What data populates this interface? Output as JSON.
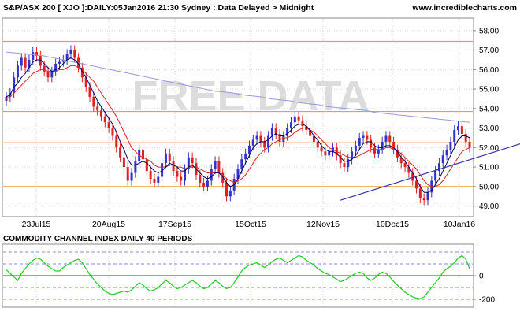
{
  "header": {
    "title": "S&P/ASX 200 [ XJO ]:DAILY:05Jan2016 21:30 Sydney : Data Delayed > Midnight",
    "site": "www.incrediblecharts.com"
  },
  "watermark": "FREE DATA",
  "colors": {
    "up_bar": "#3333cc",
    "down_bar": "#dd2222",
    "ma_fast": "#000066",
    "ma_slow": "#dd2222",
    "ma_long": "#9999dd",
    "hline": "#e8a040",
    "trendline": "#3333aa",
    "cci": "#22cc22",
    "cci_band": "#8888dd",
    "cci_zero": "#3333aa",
    "grid": "#d8d8d8"
  },
  "chart_data": [
    {
      "type": "candlestick",
      "title": "S&P/ASX 200 [ XJO ]:DAILY:05Jan2016 21:30 Sydney : Data Delayed > Midnight",
      "x_ticks": [
        "23Jul15",
        "20Aug15",
        "17Sep15",
        "15Oct15",
        "12Nov15",
        "10Dec15",
        "10Jan16"
      ],
      "y_ticks": [
        "49.00",
        "50.00",
        "51.00",
        "52.00",
        "53.00",
        "54.00",
        "55.00",
        "56.00",
        "57.00",
        "58.00"
      ],
      "ylim": [
        48.5,
        58.6
      ],
      "grid": true,
      "horizontal_lines": [
        57.45,
        53.85,
        52.25,
        50.0
      ],
      "trendline": [
        [
          88,
          49.3
        ],
        [
          142,
          52.6
        ]
      ],
      "close": [
        54.6,
        54.8,
        55.6,
        56.2,
        56.6,
        56.1,
        56.5,
        56.9,
        56.7,
        56.2,
        55.9,
        55.6,
        55.9,
        56.3,
        56.4,
        56.5,
        56.8,
        57.0,
        56.6,
        56.1,
        55.6,
        55.1,
        54.6,
        54.1,
        53.9,
        53.6,
        53.3,
        53.0,
        52.6,
        52.0,
        51.5,
        51.0,
        50.3,
        50.7,
        51.3,
        51.9,
        51.4,
        50.8,
        50.4,
        50.2,
        50.5,
        51.2,
        51.7,
        51.3,
        50.8,
        50.5,
        50.3,
        50.9,
        51.5,
        51.2,
        50.6,
        50.2,
        50.0,
        50.3,
        50.9,
        51.3,
        50.7,
        50.2,
        49.5,
        49.8,
        50.4,
        50.9,
        51.4,
        51.7,
        52.1,
        52.4,
        52.6,
        52.3,
        52.0,
        52.6,
        53.0,
        52.7,
        52.3,
        52.6,
        53.0,
        53.3,
        53.6,
        53.4,
        53.1,
        52.9,
        52.6,
        52.3,
        52.0,
        51.8,
        51.6,
        51.8,
        52.0,
        51.6,
        51.2,
        51.0,
        51.4,
        51.8,
        52.1,
        52.5,
        52.6,
        52.4,
        52.0,
        51.7,
        51.9,
        52.3,
        52.6,
        52.3,
        51.9,
        51.5,
        51.2,
        51.0,
        50.7,
        50.3,
        49.9,
        49.4,
        49.3,
        49.7,
        50.3,
        50.8,
        51.2,
        51.6,
        51.9,
        52.3,
        52.9,
        53.1,
        52.7,
        52.3,
        52.0
      ],
      "ma_fast": [
        54.6,
        54.7,
        55.1,
        55.3,
        55.6,
        55.8,
        56.1,
        56.4,
        56.5,
        56.5,
        56.3,
        56.1,
        55.9,
        56.0,
        56.1,
        56.3,
        56.5,
        56.6,
        56.5,
        56.3,
        55.9,
        55.6,
        55.2,
        54.8,
        54.4,
        54.1,
        53.8,
        53.5,
        53.2,
        52.8,
        52.3,
        51.9,
        51.4,
        51.1,
        51.1,
        51.2,
        51.3,
        51.2,
        51.0,
        50.8,
        50.7,
        50.8,
        51.0,
        51.2,
        51.1,
        51.0,
        50.8,
        50.8,
        51.0,
        51.1,
        50.9,
        50.7,
        50.5,
        50.4,
        50.5,
        50.7,
        50.7,
        50.5,
        50.2,
        50.0,
        50.1,
        50.4,
        50.8,
        51.2,
        51.6,
        52.0,
        52.2,
        52.3,
        52.3,
        52.4,
        52.6,
        52.7,
        52.6,
        52.6,
        52.7,
        52.9,
        53.1,
        53.2,
        53.2,
        53.1,
        52.9,
        52.6,
        52.4,
        52.1,
        51.9,
        51.8,
        51.8,
        51.7,
        51.5,
        51.3,
        51.3,
        51.4,
        51.6,
        51.9,
        52.2,
        52.3,
        52.3,
        52.1,
        52.0,
        52.0,
        52.1,
        52.1,
        52.0,
        51.8,
        51.5,
        51.3,
        51.0,
        50.7,
        50.4,
        50.0,
        49.7,
        49.7,
        49.8,
        50.1,
        50.4,
        50.8,
        51.2,
        51.6,
        52.0,
        52.4,
        52.6,
        52.6,
        52.5
      ],
      "ma_slow": [
        54.5,
        54.6,
        54.8,
        55.0,
        55.2,
        55.4,
        55.6,
        55.8,
        55.9,
        56.0,
        56.0,
        55.9,
        55.9,
        55.9,
        56.0,
        56.0,
        56.1,
        56.2,
        56.2,
        56.1,
        56.0,
        55.8,
        55.6,
        55.4,
        55.1,
        54.8,
        54.5,
        54.2,
        53.9,
        53.6,
        53.2,
        52.8,
        52.4,
        52.0,
        51.8,
        51.6,
        51.5,
        51.4,
        51.3,
        51.1,
        51.0,
        51.0,
        51.0,
        51.1,
        51.1,
        51.0,
        51.0,
        50.9,
        51.0,
        51.0,
        51.0,
        50.9,
        50.8,
        50.7,
        50.7,
        50.7,
        50.7,
        50.6,
        50.4,
        50.3,
        50.2,
        50.3,
        50.4,
        50.6,
        50.9,
        51.2,
        51.5,
        51.7,
        51.9,
        52.0,
        52.2,
        52.3,
        52.4,
        52.5,
        52.5,
        52.6,
        52.8,
        52.9,
        53.0,
        53.0,
        52.9,
        52.8,
        52.6,
        52.4,
        52.2,
        52.0,
        51.9,
        51.8,
        51.7,
        51.6,
        51.5,
        51.5,
        51.5,
        51.6,
        51.7,
        51.8,
        51.9,
        51.9,
        51.9,
        51.9,
        52.0,
        52.0,
        51.9,
        51.8,
        51.7,
        51.5,
        51.3,
        51.1,
        50.9,
        50.6,
        50.3,
        50.1,
        50.0,
        50.0,
        50.1,
        50.3,
        50.6,
        50.9,
        51.2,
        51.5,
        51.8,
        51.9,
        52.0
      ],
      "ma_long": [
        56.9,
        56.85,
        56.8,
        56.75,
        56.7,
        56.6,
        56.5,
        56.4,
        56.3,
        56.2,
        56.1,
        56.0,
        55.9,
        55.8,
        55.7,
        55.6,
        55.5,
        55.4,
        55.3,
        55.2,
        55.1,
        55.0,
        54.9,
        54.85,
        54.8,
        54.7,
        54.65,
        54.6,
        54.5,
        54.45,
        54.4,
        54.3,
        54.25,
        54.2,
        54.1,
        54.05,
        54.0,
        53.95,
        53.9,
        53.8,
        53.75,
        53.7,
        53.65,
        53.6,
        53.55,
        53.5,
        53.45,
        53.4,
        53.35,
        53.3
      ]
    },
    {
      "type": "line",
      "title": "COMMODITY CHANNEL INDEX DAILY 40 PERIODS",
      "y_ticks": [
        "0",
        "-200"
      ],
      "ylim": [
        -260,
        260
      ],
      "band_levels": [
        200,
        100,
        -100,
        -200
      ],
      "values": [
        50,
        20,
        -10,
        -40,
        20,
        60,
        100,
        130,
        150,
        140,
        110,
        80,
        60,
        40,
        40,
        70,
        90,
        110,
        130,
        140,
        110,
        60,
        10,
        -30,
        -70,
        -100,
        -130,
        -150,
        -160,
        -150,
        -140,
        -130,
        -140,
        -120,
        -90,
        -60,
        -80,
        -110,
        -130,
        -120,
        -100,
        -70,
        -40,
        -60,
        -90,
        -110,
        -100,
        -80,
        -60,
        -40,
        -60,
        -90,
        -110,
        -100,
        -70,
        -40,
        -60,
        -90,
        -110,
        -100,
        -60,
        -10,
        40,
        70,
        90,
        100,
        110,
        90,
        70,
        90,
        120,
        140,
        150,
        130,
        110,
        130,
        150,
        170,
        160,
        130,
        110,
        90,
        60,
        40,
        20,
        10,
        -10,
        -30,
        -50,
        -40,
        -20,
        0,
        20,
        30,
        20,
        -20,
        -40,
        -20,
        10,
        30,
        20,
        -10,
        -50,
        -80,
        -110,
        -140,
        -160,
        -180,
        -190,
        -195,
        -180,
        -140,
        -100,
        -60,
        -20,
        30,
        60,
        80,
        110,
        150,
        170,
        140,
        60
      ]
    }
  ]
}
